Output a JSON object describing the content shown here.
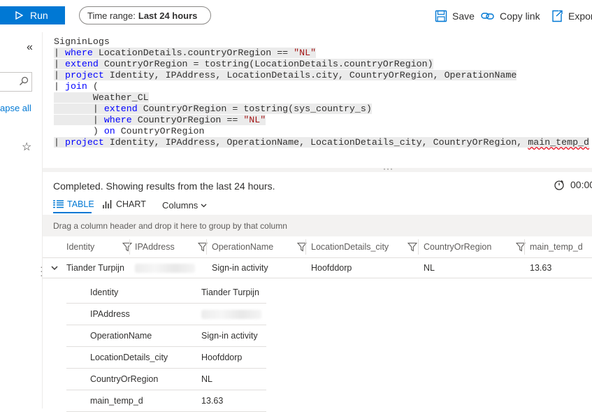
{
  "toolbar": {
    "run_label": "Run",
    "time_range_label": "Time range:",
    "time_range_value": "Last 24 hours",
    "save_label": "Save",
    "copy_link_label": "Copy link",
    "export_label": "Expor"
  },
  "left_panel": {
    "collapse_all_label": "apse all"
  },
  "query": {
    "lines": [
      {
        "plain": "SigninLogs"
      },
      {
        "kw": "where",
        "rest": " LocationDetails.countryOrRegion == ",
        "str": "\"NL\""
      },
      {
        "kw": "extend",
        "rest": " CountryOrRegion = tostring(LocationDetails.countryOrRegion)"
      },
      {
        "kw": "project",
        "rest": " Identity, IPAddress, LocationDetails.city, CountryOrRegion, OperationName"
      },
      {
        "kw": "join",
        "rest": " ("
      },
      {
        "plain": "Weather_CL"
      },
      {
        "kw": "extend",
        "rest": " CountryOrRegion = tostring(sys_country_s)"
      },
      {
        "kw": "where",
        "rest": " CountryOrRegion == ",
        "str": "\"NL\""
      },
      {
        "plain_pre": ") ",
        "kw": "on",
        "rest": " CountryOrRegion"
      },
      {
        "kw": "project",
        "rest": " Identity, IPAddress, OperationName, LocationDetails_city, CountryOrRegion, ",
        "squig": "main_temp_d"
      }
    ]
  },
  "results": {
    "status_text": "Completed. Showing results from the last 24 hours.",
    "elapsed": "00:00",
    "tab_table": "TABLE",
    "tab_chart": "CHART",
    "columns_label": "Columns",
    "group_hint": "Drag a column header and drop it here to group by that column",
    "columns": [
      "Identity",
      "IPAddress",
      "OperationName",
      "LocationDetails_city",
      "CountryOrRegion",
      "main_temp_d"
    ],
    "row": {
      "identity": "Tiander Turpijn",
      "operation": "Sign-in activity",
      "city": "Hoofddorp",
      "country": "NL",
      "temp": "13.63"
    },
    "detail": [
      {
        "key": "Identity",
        "value": "Tiander Turpijn"
      },
      {
        "key": "IPAddress",
        "value": ""
      },
      {
        "key": "OperationName",
        "value": "Sign-in activity"
      },
      {
        "key": "LocationDetails_city",
        "value": "Hoofddorp"
      },
      {
        "key": "CountryOrRegion",
        "value": "NL"
      },
      {
        "key": "main_temp_d",
        "value": "13.63"
      }
    ]
  },
  "colors": {
    "accent": "#0078d4",
    "keyword": "#0000ff",
    "string": "#a31515"
  }
}
